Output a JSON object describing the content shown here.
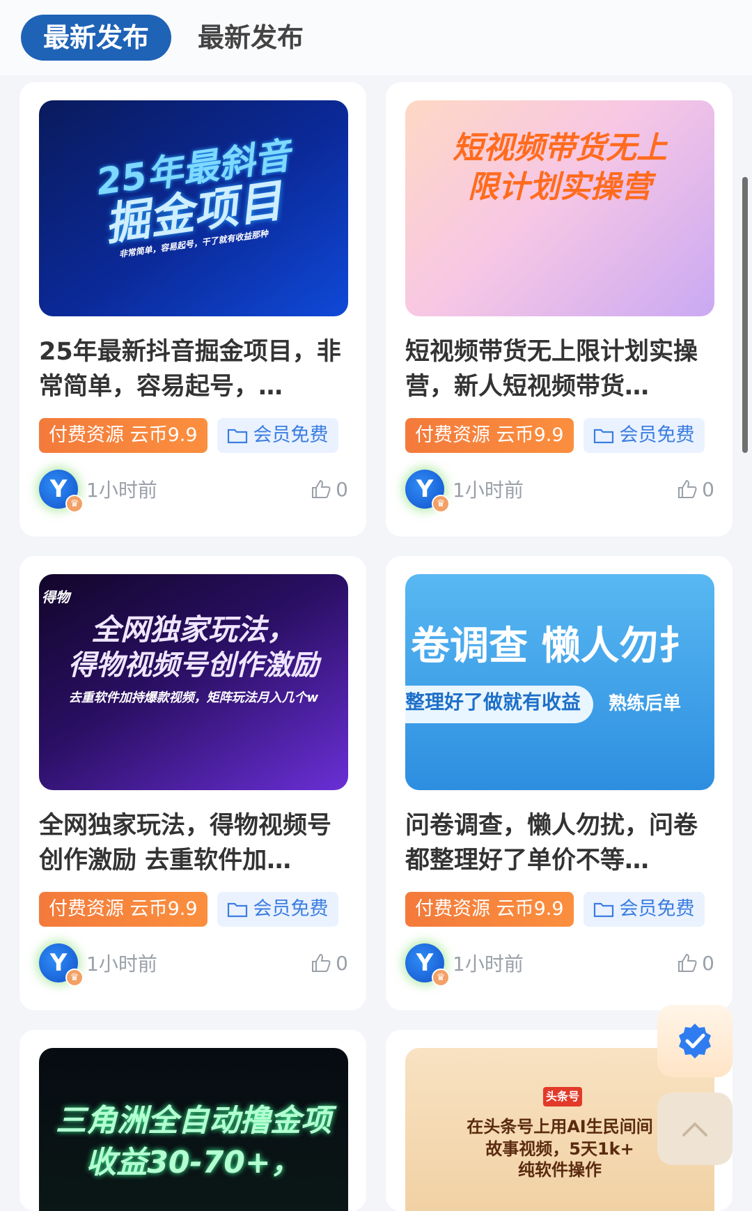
{
  "tabs": {
    "active": "最新发布",
    "inactive": "最新发布"
  },
  "cards": [
    {
      "thumb": [
        "25年最斜音",
        "掘金项目",
        "非常简单，容易起号，干了就有收益那种"
      ],
      "title": "25年最新抖音掘金项目，非常简单，容易起号，…",
      "paid_tag": "付费资源 云币9.9",
      "free_tag": "会员免费",
      "avatar": "Y",
      "time": "1小时前",
      "likes": "0"
    },
    {
      "thumb": [
        "短视频带货无上",
        "限计划实操营"
      ],
      "title": "短视频带货无上限计划实操营，新人短视频带货…",
      "paid_tag": "付费资源 云币9.9",
      "free_tag": "会员免费",
      "avatar": "Y",
      "time": "1小时前",
      "likes": "0"
    },
    {
      "thumb": [
        "全网独家玩法，",
        "得物视频号创作激励",
        "去重软件加持爆款视频，矩阵玩法月入几个w",
        "得物"
      ],
      "title": "全网独家玩法，得物视频号创作激励 去重软件加…",
      "paid_tag": "付费资源 云币9.9",
      "free_tag": "会员免费",
      "avatar": "Y",
      "time": "1小时前",
      "likes": "0"
    },
    {
      "thumb": [
        "卷调查  懒人勿扌",
        "整理好了做就有收益",
        "熟练后单"
      ],
      "title": "问卷调查，懒人勿扰，问卷都整理好了单价不等…",
      "paid_tag": "付费资源 云币9.9",
      "free_tag": "会员免费",
      "avatar": "Y",
      "time": "1小时前",
      "likes": "0"
    },
    {
      "thumb": [
        "三角洲全自动撸金项",
        "收益30-70+，"
      ]
    },
    {
      "thumb": [
        "头条号",
        "在头条号上用AI生民间间",
        "故事视频，5天1k+",
        "纯软件操作"
      ]
    }
  ],
  "colors": {
    "accent": "#1f63b6",
    "paid": "#f37a3b",
    "free": "#3b7de0"
  }
}
